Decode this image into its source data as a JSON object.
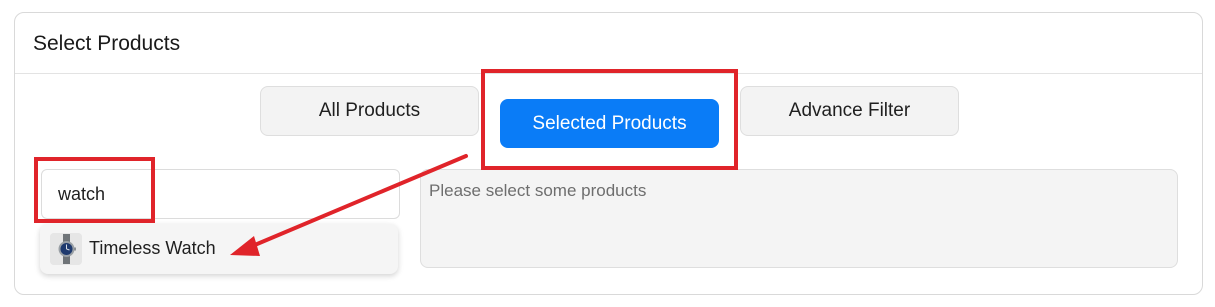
{
  "panel": {
    "title": "Select Products"
  },
  "tabs": [
    {
      "label": "All Products",
      "active": false
    },
    {
      "label": "Selected Products",
      "active": true
    },
    {
      "label": "Advance Filter",
      "active": false
    }
  ],
  "search": {
    "value": "watch"
  },
  "selected_products": {
    "placeholder": "Please select some products"
  },
  "search_results": [
    {
      "label": "Timeless Watch",
      "thumbnail_icon": "wristwatch-icon"
    }
  ],
  "annotations": {
    "color": "#e0242a"
  },
  "colors": {
    "accent": "#0a7cf7",
    "inactive_tab_bg": "#f3f3f3",
    "annotation_red": "#e0242a"
  }
}
